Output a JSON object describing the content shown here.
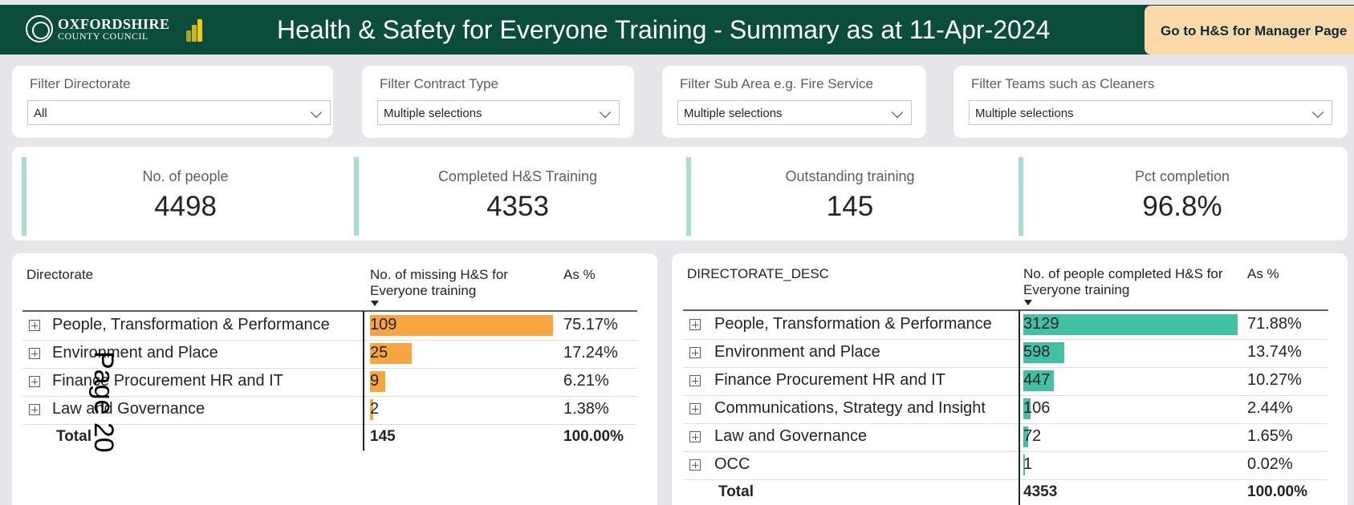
{
  "header": {
    "logo_line1": "OXFORDSHIRE",
    "logo_line2": "COUNTY COUNCIL",
    "title": "Health & Safety for Everyone Training - Summary as at 11-Apr-2024",
    "manager_button": "Go to H&S for Manager Page",
    "background": "#0b4d3c",
    "button_color": "#fbd9a8"
  },
  "filters": [
    {
      "label": "Filter Directorate",
      "value": "All"
    },
    {
      "label": "Filter Contract Type",
      "value": "Multiple selections"
    },
    {
      "label": "Filter Sub Area e.g. Fire Service",
      "value": "Multiple selections"
    },
    {
      "label": "Filter Teams such as Cleaners",
      "value": "Multiple selections"
    }
  ],
  "kpis": [
    {
      "label": "No. of people",
      "value": "4498"
    },
    {
      "label": "Completed H&S Training",
      "value": "4353"
    },
    {
      "label": "Outstanding training",
      "value": "145"
    },
    {
      "label": "Pct completion",
      "value": "96.8%"
    }
  ],
  "missing_table": {
    "col1": "Directorate",
    "col2": "No. of missing H&S for Everyone training",
    "col3": "As %",
    "bar_color": "#f7a540",
    "max": 109,
    "rows": [
      {
        "name": "People, Transformation & Performance",
        "value": 109,
        "pct": "75.17%"
      },
      {
        "name": "Environment and Place",
        "value": 25,
        "pct": "17.24%"
      },
      {
        "name": "Finance Procurement HR and IT",
        "value": 9,
        "pct": "6.21%"
      },
      {
        "name": "Law and Governance",
        "value": 2,
        "pct": "1.38%"
      }
    ],
    "total_label": "Total",
    "total_value": "145",
    "total_pct": "100.00%"
  },
  "completed_table": {
    "col1": "DIRECTORATE_DESC",
    "col2": "No. of people completed H&S for Everyone training",
    "col3": "As %",
    "bar_color": "#41c0a6",
    "max": 3129,
    "rows": [
      {
        "name": "People, Transformation & Performance",
        "value": 3129,
        "pct": "71.88%"
      },
      {
        "name": "Environment and Place",
        "value": 598,
        "pct": "13.74%"
      },
      {
        "name": "Finance Procurement HR and IT",
        "value": 447,
        "pct": "10.27%"
      },
      {
        "name": "Communications, Strategy and Insight",
        "value": 106,
        "pct": "2.44%"
      },
      {
        "name": "Law and Governance",
        "value": 72,
        "pct": "1.65%"
      },
      {
        "name": "OCC",
        "value": 1,
        "pct": "0.02%"
      }
    ],
    "total_label": "Total",
    "total_value": "4353",
    "total_pct": "100.00%"
  },
  "overlay": "Page 20"
}
